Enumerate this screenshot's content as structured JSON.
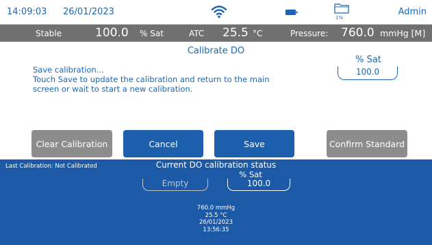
{
  "header": {
    "time": "14:09:03",
    "date": "26/01/2023",
    "user": "Admin",
    "storage_percent": "1%",
    "icons": [
      "wifi-icon",
      "battery-icon",
      "folder-icon"
    ]
  },
  "measurement": {
    "stability": "Stable",
    "do_value": "100.0",
    "do_unit": "% Sat",
    "temp_mode": "ATC",
    "temperature": "25.5",
    "temp_unit": "°C",
    "pressure_label": "Pressure:",
    "pressure_value": "760.0",
    "pressure_unit": "mmHg [M]"
  },
  "title": "Calibrate DO",
  "message": {
    "line1": "Save calibration...",
    "line2": "Touch Save to update the calibration and return to the main",
    "line3": "screen or wait to start a new calibration."
  },
  "standard": {
    "unit": "% Sat",
    "value": "100.0"
  },
  "buttons": {
    "clear": "Clear Calibration",
    "cancel": "Cancel",
    "save": "Save",
    "confirm": "Confirm Standard"
  },
  "status": {
    "last_calibration": "Last Calibration:  Not Calibrated",
    "title": "Current DO calibration status",
    "unit": "% Sat",
    "empty_slot": "Empty",
    "value": "100.0",
    "pressure": "760.0 mmHg",
    "temperature": "25.5 °C",
    "date": "26/01/2023",
    "time": "13:56:35"
  },
  "colors": {
    "accent": "#1a66b6",
    "panel": "#1c5aa8",
    "measbar": "#707070",
    "button_disabled": "#8d8d8d",
    "button_active": "#1b5fad"
  }
}
